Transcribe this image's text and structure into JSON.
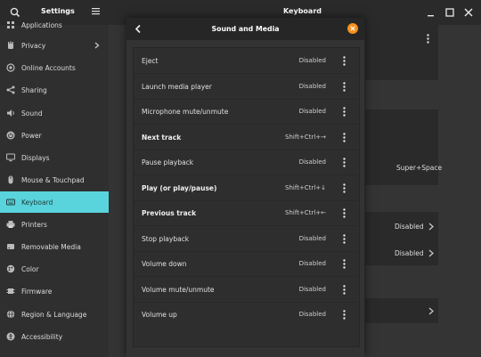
{
  "header": {
    "settings_title": "Settings",
    "window_title": "Keyboard"
  },
  "sidebar": {
    "items": [
      {
        "label": "Applications",
        "icon": "apps-icon"
      },
      {
        "label": "Privacy",
        "icon": "hand-icon"
      },
      {
        "label": "Online Accounts",
        "icon": "at-icon"
      },
      {
        "label": "Sharing",
        "icon": "share-icon"
      },
      {
        "label": "Sound",
        "icon": "speaker-icon"
      },
      {
        "label": "Power",
        "icon": "power-icon"
      },
      {
        "label": "Displays",
        "icon": "display-icon"
      },
      {
        "label": "Mouse & Touchpad",
        "icon": "mouse-icon"
      },
      {
        "label": "Keyboard",
        "icon": "keyboard-icon"
      },
      {
        "label": "Printers",
        "icon": "printer-icon"
      },
      {
        "label": "Removable Media",
        "icon": "media-icon"
      },
      {
        "label": "Color",
        "icon": "color-icon"
      },
      {
        "label": "Firmware",
        "icon": "firmware-icon"
      },
      {
        "label": "Region & Language",
        "icon": "globe-icon"
      },
      {
        "label": "Accessibility",
        "icon": "accessibility-icon"
      }
    ],
    "active": "Keyboard"
  },
  "main": {
    "super_space": "Super+Space",
    "disabled_1": "Disabled",
    "disabled_2": "Disabled"
  },
  "dialog": {
    "title": "Sound and Media",
    "rows": [
      {
        "name": "Eject",
        "accel": "Disabled",
        "bold": false
      },
      {
        "name": "Launch media player",
        "accel": "Disabled",
        "bold": false
      },
      {
        "name": "Microphone mute/unmute",
        "accel": "Disabled",
        "bold": false
      },
      {
        "name": "Next track",
        "accel": "Shift+Ctrl+→",
        "bold": true
      },
      {
        "name": "Pause playback",
        "accel": "Disabled",
        "bold": false
      },
      {
        "name": "Play (or play/pause)",
        "accel": "Shift+Ctrl+↓",
        "bold": true
      },
      {
        "name": "Previous track",
        "accel": "Shift+Ctrl+←",
        "bold": true
      },
      {
        "name": "Stop playback",
        "accel": "Disabled",
        "bold": false
      },
      {
        "name": "Volume down",
        "accel": "Disabled",
        "bold": false
      },
      {
        "name": "Volume mute/unmute",
        "accel": "Disabled",
        "bold": false
      },
      {
        "name": "Volume up",
        "accel": "Disabled",
        "bold": false
      }
    ]
  },
  "colors": {
    "accent": "#5ad4dc",
    "close": "#f6911d"
  }
}
